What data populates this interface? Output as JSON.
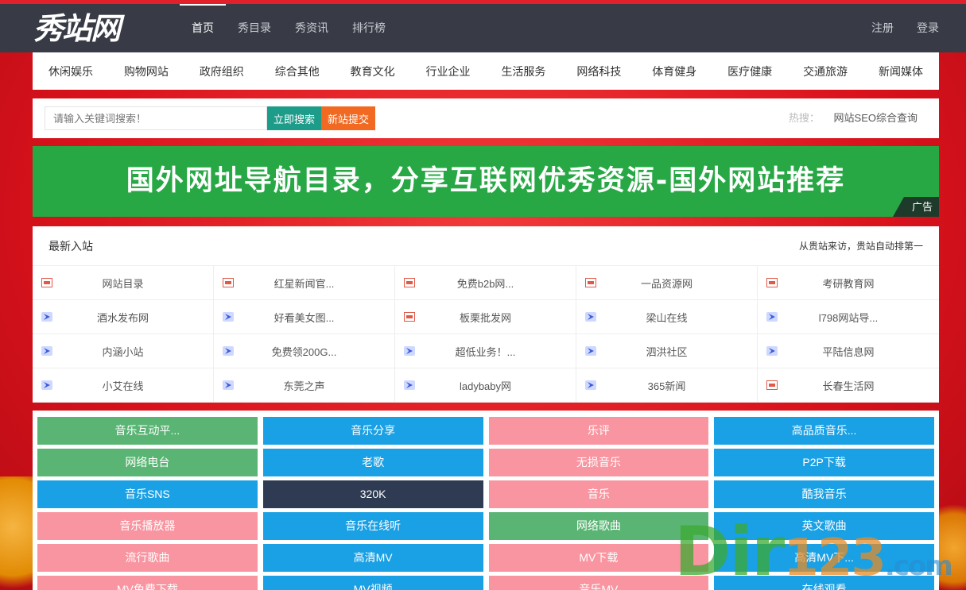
{
  "logo": "秀站网",
  "nav": [
    "首页",
    "秀目录",
    "秀资讯",
    "排行榜"
  ],
  "auth": {
    "register": "注册",
    "login": "登录"
  },
  "categories": [
    "休闲娱乐",
    "购物网站",
    "政府组织",
    "综合其他",
    "教育文化",
    "行业企业",
    "生活服务",
    "网络科技",
    "体育健身",
    "医疗健康",
    "交通旅游",
    "新闻媒体"
  ],
  "search": {
    "placeholder": "请输入关键词搜索！",
    "search_label": "立即搜索",
    "submit_label": "新站提交",
    "hot_label": "热搜：",
    "hot_link": "网站SEO综合查询"
  },
  "banner": {
    "text": "国外网址导航目录，分享互联网优秀资源-国外网站推荐",
    "ad_label": "广告"
  },
  "latest": {
    "title": "最新入站",
    "subtitle": "从贵站来访，贵站自动排第一",
    "items": [
      {
        "name": "网站目录",
        "icon": "favicon-red"
      },
      {
        "name": "红星新闻官...",
        "icon": "favicon-red"
      },
      {
        "name": "免费b2b网...",
        "icon": "favicon-red"
      },
      {
        "name": "一品资源网",
        "icon": "favicon-red"
      },
      {
        "name": "考研教育网",
        "icon": "favicon-red"
      },
      {
        "name": "酒水发布网",
        "icon": "favicon-x"
      },
      {
        "name": "好看美女图...",
        "icon": "favicon-x"
      },
      {
        "name": "板栗批发网",
        "icon": "favicon-red"
      },
      {
        "name": "梁山在线",
        "icon": "favicon-x"
      },
      {
        "name": "l798网站导...",
        "icon": "favicon-x"
      },
      {
        "name": "内涵小站",
        "icon": "favicon-x"
      },
      {
        "name": "免费领200G...",
        "icon": "favicon-x"
      },
      {
        "name": "超低业务！...",
        "icon": "favicon-x"
      },
      {
        "name": "泗洪社区",
        "icon": "favicon-x"
      },
      {
        "name": "平陆信息网",
        "icon": "favicon-x"
      },
      {
        "name": "小艾在线",
        "icon": "favicon-x"
      },
      {
        "name": "东莞之声",
        "icon": "favicon-x"
      },
      {
        "name": "ladybaby网",
        "icon": "favicon-x"
      },
      {
        "name": "365新闻",
        "icon": "favicon-x"
      },
      {
        "name": "长春生活网",
        "icon": "favicon-red"
      }
    ]
  },
  "tags": [
    {
      "label": "音乐互动平...",
      "color": "green"
    },
    {
      "label": "音乐分享",
      "color": "blue"
    },
    {
      "label": "乐评",
      "color": "pink"
    },
    {
      "label": "高品质音乐...",
      "color": "blue"
    },
    {
      "label": "网络电台",
      "color": "green"
    },
    {
      "label": "老歌",
      "color": "blue"
    },
    {
      "label": "无损音乐",
      "color": "pink"
    },
    {
      "label": "P2P下载",
      "color": "blue"
    },
    {
      "label": "音乐SNS",
      "color": "blue"
    },
    {
      "label": "320K",
      "color": "dark"
    },
    {
      "label": "音乐",
      "color": "pink"
    },
    {
      "label": "酷我音乐",
      "color": "blue"
    },
    {
      "label": "音乐播放器",
      "color": "pink"
    },
    {
      "label": "音乐在线听",
      "color": "blue"
    },
    {
      "label": "网络歌曲",
      "color": "green"
    },
    {
      "label": "英文歌曲",
      "color": "blue"
    },
    {
      "label": "流行歌曲",
      "color": "pink"
    },
    {
      "label": "高清MV",
      "color": "blue"
    },
    {
      "label": "MV下载",
      "color": "pink"
    },
    {
      "label": "高清MV下...",
      "color": "blue"
    },
    {
      "label": "MV免费下载",
      "color": "pink"
    },
    {
      "label": "MV视频",
      "color": "blue"
    },
    {
      "label": "音乐MV",
      "color": "pink"
    },
    {
      "label": "在线观看",
      "color": "blue"
    }
  ],
  "watermark": {
    "a": "Dir",
    "b": "123",
    "c": ".com"
  }
}
